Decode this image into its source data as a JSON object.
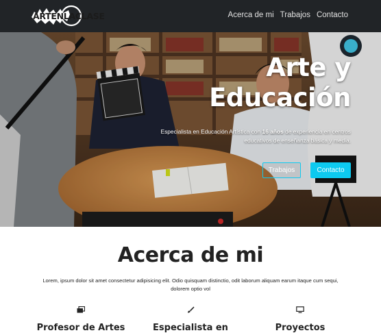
{
  "brand": {
    "logo_text": "ARTENLACLASE"
  },
  "nav": {
    "items": [
      "Acerca de mi",
      "Trabajos",
      "Contacto"
    ]
  },
  "hero": {
    "title_line1": "Arte y",
    "title_line2": "Educación",
    "subtitle_pre": "Especialista en Educación Artística con ",
    "subtitle_bold": "16 años",
    "subtitle_post": " de experiencia en centros educativos de enseñanza básica y media.",
    "btn_works": "Trabajos",
    "btn_contact": "Contacto"
  },
  "about": {
    "title": "Acerca de mi",
    "text": "Lorem, ipsum dolor sit amet consectetur adipisicing elit. Odio quisquam distinctio, odit laborum aliquam earum itaque cum sequi, dolorem optio vol",
    "features": [
      {
        "icon": "images-icon",
        "title": "Profesor de Artes"
      },
      {
        "icon": "brush-icon",
        "title": "Especialista en"
      },
      {
        "icon": "monitor-icon",
        "title": "Proyectos"
      }
    ]
  },
  "colors": {
    "navbar": "#212427",
    "accent": "#0dcaf0",
    "text": "#222222"
  }
}
